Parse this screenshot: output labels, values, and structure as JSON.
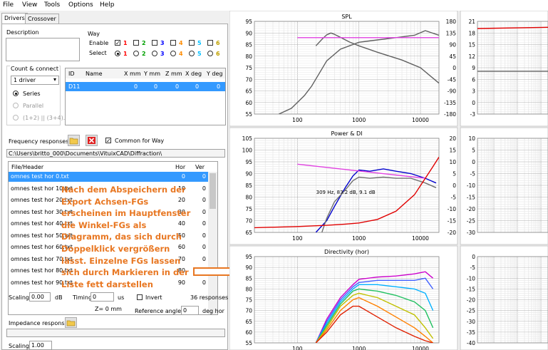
{
  "menu": [
    "File",
    "View",
    "Tools",
    "Options",
    "Help"
  ],
  "tabs": [
    "Drivers",
    "Crossover"
  ],
  "left": {
    "description_label": "Description",
    "way_label": "Way",
    "enable_label": "Enable",
    "select_label": "Select",
    "way_numbers": [
      "1",
      "2",
      "3",
      "4",
      "5",
      "6"
    ],
    "way_colors": [
      "#ff0000",
      "#00a000",
      "#0000ff",
      "#ff8c00",
      "#00bfff",
      "#bfa000"
    ],
    "count_label": "Count & connect",
    "count_value": "1 driver",
    "series_label": "Series",
    "parallel_label": "Parallel",
    "combo_label": "(1+2) || (3+4)...",
    "driver_headers": [
      "ID",
      "Name",
      "X mm",
      "Y mm",
      "Z mm",
      "X deg",
      "Y deg"
    ],
    "driver_row": [
      "D11",
      "",
      "0",
      "0",
      "0",
      "0",
      "0"
    ],
    "freq_label": "Frequency responses",
    "common_label": "Common for Way",
    "path": "C:\\Users\\britto_000\\Documents\\VituixCAD\\Diffraction\\",
    "list_headers": [
      "File/Header",
      "Hor",
      "Ver"
    ],
    "files": [
      {
        "name": "omnes test hor 0.txt",
        "hor": "0",
        "ver": "0"
      },
      {
        "name": "omnes test hor 10.txt",
        "hor": "10",
        "ver": "0"
      },
      {
        "name": "omnes test hor 20.txt",
        "hor": "20",
        "ver": "0"
      },
      {
        "name": "omnes test hor 30.txt",
        "hor": "30",
        "ver": "0"
      },
      {
        "name": "omnes test hor 40.txt",
        "hor": "40",
        "ver": "0"
      },
      {
        "name": "omnes test hor 50.txt",
        "hor": "50",
        "ver": "0"
      },
      {
        "name": "omnes test hor 60.txt",
        "hor": "60",
        "ver": "0"
      },
      {
        "name": "omnes test hor 70.txt",
        "hor": "70",
        "ver": "0"
      },
      {
        "name": "omnes test hor 80.txt",
        "hor": "80",
        "ver": "0"
      },
      {
        "name": "omnes test hor 90.txt",
        "hor": "90",
        "ver": "0"
      }
    ],
    "scaling_label": "Scaling",
    "scaling_value": "0.00",
    "db_label": "dB",
    "timing_label": "Timing",
    "timing_value": "0",
    "us_label": "us",
    "invert_label": "Invert",
    "responses_count": "36 responses",
    "z_label": "Z= 0 mm",
    "ref_angle_label": "Reference angle",
    "ref_angle_value": "0",
    "deg_hor_label": "deg hor",
    "impedance_label": "Impedance response",
    "scaling2_label": "Scaling",
    "scaling2_value": "1.00"
  },
  "annotation": "Nach dem Abspeichern der\nExport Achsen-FGs\nerscheinen im Hauptfenster\ndie Winkel-FGs als\nDiagramm, das sich durch\nDoppelklick vergrößern\nlässt. Einzelne FGs lassen\nsich durch Markieren in der\nListe fett darstellen",
  "chart_data": [
    {
      "type": "line",
      "title": "SPL",
      "xscale": "log",
      "xlim": [
        20,
        20000
      ],
      "xticks": [
        "100",
        "1000",
        "10000"
      ],
      "ylim": [
        55,
        95
      ],
      "yticks": [
        "95",
        "90",
        "85",
        "80",
        "75",
        "70",
        "65",
        "60",
        "55"
      ],
      "y2lim": [
        -180,
        180
      ],
      "y2ticks": [
        "180",
        "135",
        "90",
        "45",
        "0",
        "-45",
        "-90",
        "-135",
        "-180"
      ],
      "series": [
        {
          "color": "#606060",
          "x": [
            50,
            80,
            100,
            130,
            170,
            220,
            300,
            500,
            1000,
            2000,
            4000,
            8000,
            12000,
            20000
          ],
          "y": [
            55,
            57.5,
            60,
            63,
            67,
            72,
            78,
            83,
            86,
            87,
            88,
            89,
            91,
            89
          ]
        },
        {
          "color": "#606060",
          "y_axis": "right",
          "x": [
            200,
            250,
            300,
            350,
            400,
            500,
            700,
            1000,
            2000,
            5000,
            10000,
            20000
          ],
          "y": [
            85,
            110,
            128,
            135,
            130,
            118,
            100,
            85,
            60,
            30,
            0,
            -60
          ]
        },
        {
          "color": "#e040e0",
          "x": [
            100,
            20000
          ],
          "y": [
            88,
            88
          ]
        }
      ]
    },
    {
      "type": "line",
      "title": "Power & DI",
      "xscale": "log",
      "xlim": [
        20,
        20000
      ],
      "xticks": [
        "100",
        "1000",
        "10000"
      ],
      "ylim": [
        65,
        105
      ],
      "yticks": [
        "105",
        "100",
        "95",
        "90",
        "85",
        "80",
        "75",
        "70",
        "65"
      ],
      "y2lim": [
        -20,
        20
      ],
      "y2ticks": [
        "20",
        "15",
        "10",
        "5",
        "0",
        "-5",
        "-10",
        "-15",
        "-20"
      ],
      "annotations": [
        "309 Hz, 83.2 dB, 9.1 dB"
      ],
      "series": [
        {
          "color": "#0000cc",
          "x": [
            200,
            300,
            400,
            600,
            800,
            1000,
            1500,
            2500,
            4000,
            7000,
            12000,
            18000
          ],
          "y": [
            65,
            70,
            76,
            84,
            89,
            91.5,
            91,
            92,
            91,
            90,
            88,
            86
          ]
        },
        {
          "color": "#707070",
          "x": [
            250,
            300,
            400,
            600,
            800,
            1000,
            1500,
            2500,
            4000,
            7000,
            12000,
            18000
          ],
          "y": [
            65,
            71,
            78,
            83,
            87,
            88.5,
            88,
            88.5,
            88,
            88,
            86,
            84
          ]
        },
        {
          "color": "#e040e0",
          "x": [
            100,
            12000
          ],
          "y": [
            94,
            88
          ]
        },
        {
          "color": "#e00000",
          "y_axis": "right",
          "x": [
            20,
            100,
            300,
            600,
            1000,
            2000,
            4000,
            8000,
            12000,
            16000,
            20000
          ],
          "y": [
            -18,
            -17.5,
            -17,
            -16.5,
            -16,
            -14.5,
            -11,
            -4,
            3,
            8,
            12
          ]
        }
      ]
    },
    {
      "type": "line",
      "title": "Directivity (hor)",
      "xscale": "log",
      "xlim": [
        20,
        20000
      ],
      "xticks": [
        "100",
        "1000",
        "10000"
      ],
      "ylim": [
        55,
        95
      ],
      "yticks": [
        "95",
        "90",
        "85",
        "80",
        "75",
        "70",
        "65",
        "60",
        "55"
      ],
      "series": [
        {
          "color": "#cc00cc",
          "x": [
            200,
            300,
            500,
            800,
            1000,
            2000,
            4000,
            8000,
            12000,
            16000
          ],
          "y": [
            55,
            66,
            76,
            82,
            84.5,
            85.5,
            86,
            87,
            88,
            85
          ]
        },
        {
          "color": "#4060ff",
          "x": [
            200,
            300,
            500,
            800,
            1000,
            2000,
            4000,
            8000,
            12000,
            16000
          ],
          "y": [
            55,
            65,
            75,
            81,
            83,
            84,
            84,
            84,
            85,
            80
          ]
        },
        {
          "color": "#00b0ff",
          "x": [
            200,
            300,
            500,
            800,
            1000,
            2000,
            4000,
            8000,
            12000,
            16000
          ],
          "y": [
            55,
            64,
            74,
            80,
            82,
            82,
            81,
            80,
            78,
            70
          ]
        },
        {
          "color": "#20c060",
          "x": [
            200,
            300,
            500,
            800,
            1000,
            2000,
            4000,
            8000,
            12000,
            16000
          ],
          "y": [
            55,
            63,
            73,
            79,
            80,
            79,
            77,
            74,
            70,
            62
          ]
        },
        {
          "color": "#c0c000",
          "x": [
            200,
            300,
            500,
            800,
            1000,
            2000,
            4000,
            8000,
            12000,
            16000
          ],
          "y": [
            55,
            62,
            72,
            77,
            78,
            76,
            72,
            68,
            62,
            57
          ]
        },
        {
          "color": "#ff8000",
          "x": [
            200,
            300,
            500,
            800,
            1000,
            2000,
            4000,
            8000,
            12000,
            16000
          ],
          "y": [
            55,
            61,
            70,
            75,
            76,
            72,
            67,
            62,
            58,
            55
          ]
        },
        {
          "color": "#e02000",
          "x": [
            200,
            300,
            500,
            800,
            1000,
            2000,
            4000,
            8000,
            12000,
            16000
          ],
          "y": [
            55,
            60,
            68,
            72,
            72,
            67,
            62,
            58,
            56,
            55
          ]
        }
      ]
    },
    {
      "type": "line",
      "xscale": "log",
      "ylim": [
        -18,
        21
      ],
      "yticks": [
        "21",
        "18",
        "15",
        "12",
        "9",
        "6",
        "3",
        "0",
        "-3"
      ],
      "series": [
        {
          "color": "#e00000",
          "x": [
            20,
            20000
          ],
          "y": [
            18,
            18.5
          ]
        },
        {
          "color": "#707070",
          "x": [
            20,
            20000
          ],
          "y": [
            0,
            0
          ]
        }
      ]
    },
    {
      "type": "line",
      "xscale": "log",
      "ylim": [
        -30,
        10
      ],
      "yticks": [
        "10",
        "5",
        "0",
        "-5",
        "-10",
        "-15",
        "-20",
        "-25",
        "-30"
      ],
      "series": []
    },
    {
      "type": "line",
      "xscale": "log",
      "ylim": [
        -40,
        0
      ],
      "yticks": [
        "0",
        "-5",
        "-10",
        "-15",
        "-20",
        "-25",
        "-30",
        "-35",
        "-40"
      ],
      "series": []
    }
  ]
}
